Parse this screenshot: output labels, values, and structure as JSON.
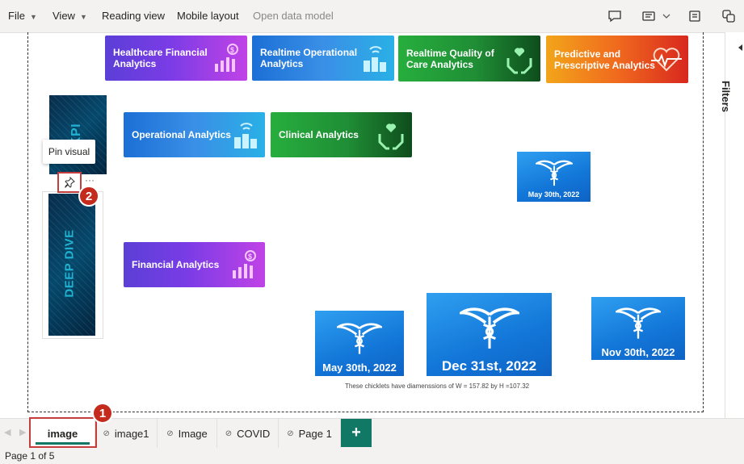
{
  "menu": {
    "file": "File",
    "view": "View",
    "reading_view": "Reading view",
    "mobile_layout": "Mobile layout",
    "open_data_model": "Open data model"
  },
  "toolbar_icons": [
    "comment-icon",
    "bookmark-icon",
    "chevron-down-icon",
    "filter-pane-icon",
    "copy-icon"
  ],
  "filters": {
    "label": "Filters"
  },
  "banners": {
    "healthcare": "Healthcare Financial Analytics",
    "realtime_operational": "Realtime Operational Analytics",
    "realtime_quality": "Realtime Quality of Care Analytics",
    "predictive": "Predictive and Prescriptive Analytics",
    "operational": "Operational Analytics",
    "clinical": "Clinical Analytics",
    "financial": "Financial Analytics"
  },
  "kpi_tiles": {
    "top": "KPI",
    "deep_dive": "DEEP DIVE"
  },
  "chicklets": {
    "small_top": "May 30th, 2022",
    "may": "May 30th, 2022",
    "dec": "Dec 31st, 2022",
    "nov": "Nov 30th, 2022"
  },
  "note": "These chicklets have diamenssions of W = 157.82 by H =107.32",
  "tooltip": {
    "text": "Pin visual"
  },
  "badges": {
    "one": "1",
    "two": "2"
  },
  "tabs": [
    {
      "label": "image",
      "active": true,
      "hidden": false
    },
    {
      "label": "image1",
      "active": false,
      "hidden": true
    },
    {
      "label": "Image",
      "active": false,
      "hidden": true
    },
    {
      "label": "COVID",
      "active": false,
      "hidden": true
    },
    {
      "label": "Page 1",
      "active": false,
      "hidden": true
    }
  ],
  "add_tab": "+",
  "status": {
    "page": "Page 1 of 5"
  },
  "colors": {
    "accent": "#117865",
    "highlight": "#c43c3c",
    "badge": "#c42b1c"
  }
}
